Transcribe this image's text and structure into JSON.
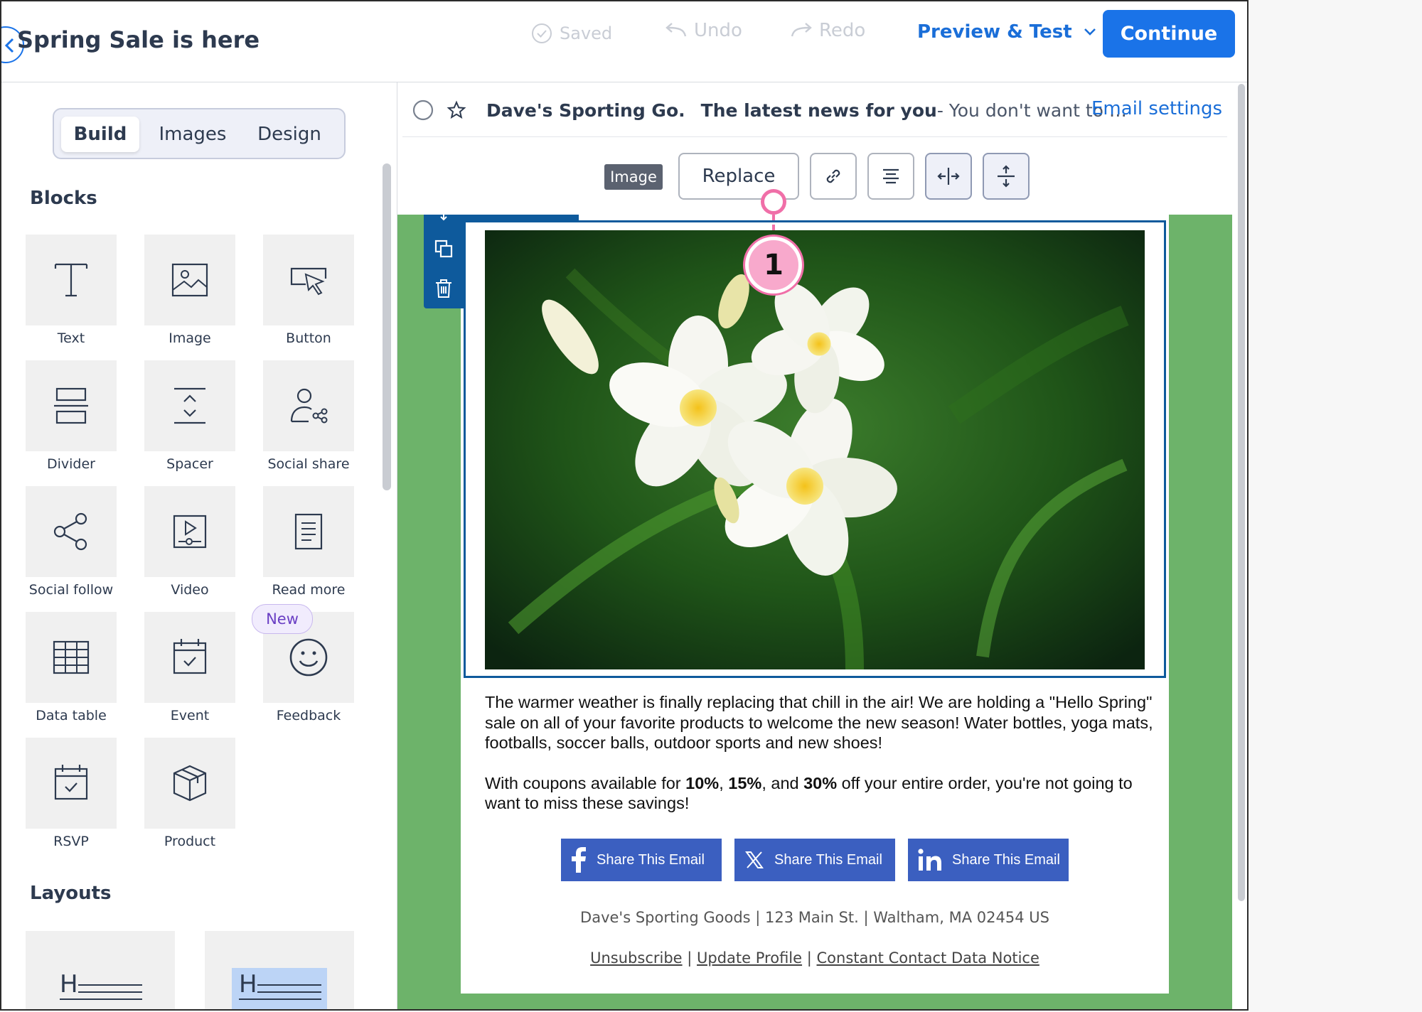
{
  "header": {
    "campaign_title": "Spring Sale is here",
    "saved_label": "Saved",
    "undo_label": "Undo",
    "redo_label": "Redo",
    "preview_label": "Preview & Test",
    "continue_label": "Continue"
  },
  "sidebar": {
    "tabs": [
      "Build",
      "Images",
      "Design"
    ],
    "active_tab": "Build",
    "blocks_heading": "Blocks",
    "blocks": [
      {
        "label": "Text",
        "icon": "text-icon"
      },
      {
        "label": "Image",
        "icon": "image-icon"
      },
      {
        "label": "Button",
        "icon": "button-icon"
      },
      {
        "label": "Divider",
        "icon": "divider-icon"
      },
      {
        "label": "Spacer",
        "icon": "spacer-icon"
      },
      {
        "label": "Social share",
        "icon": "social-share-icon"
      },
      {
        "label": "Social follow",
        "icon": "social-follow-icon"
      },
      {
        "label": "Video",
        "icon": "video-icon"
      },
      {
        "label": "Read more",
        "icon": "read-more-icon"
      },
      {
        "label": "Data table",
        "icon": "data-table-icon"
      },
      {
        "label": "Event",
        "icon": "event-icon"
      },
      {
        "label": "Feedback",
        "icon": "feedback-icon"
      },
      {
        "label": "RSVP",
        "icon": "rsvp-icon"
      },
      {
        "label": "Product",
        "icon": "product-icon"
      }
    ],
    "new_badge": "New",
    "layouts_heading": "Layouts"
  },
  "email_info": {
    "sender": "Dave's Sporting Go.",
    "subject": "The latest news for you",
    "preheader": " - You don't want to …",
    "settings_link": "Email settings"
  },
  "toolbar": {
    "block_type_tag": "Image",
    "replace_label": "Replace"
  },
  "callout": {
    "number": "1",
    "color": "#f06fa8"
  },
  "email": {
    "paragraph1": "The warmer weather is finally replacing that chill in the air! We are holding a \"Hello Spring\" sale on all of your favorite products to welcome the new season! Water bottles, yoga mats, footballs, soccer balls, outdoor sports and new shoes!",
    "paragraph2_a": "With coupons available for ",
    "pct1": "10%",
    "sep1": ", ",
    "pct2": "15%",
    "sep2": ", and ",
    "pct3": "30%",
    "paragraph2_b": " off your entire order, you're not going to want to miss these savings!",
    "share_buttons": [
      {
        "label": "Share This Email",
        "icon": "facebook-icon"
      },
      {
        "label": "Share This Email",
        "icon": "x-icon"
      },
      {
        "label": "Share This Email",
        "icon": "linkedin-icon"
      }
    ],
    "footer_address": "Dave's Sporting Goods | 123 Main St. | Waltham, MA 02454 US",
    "footer_links": [
      "Unsubscribe",
      "Update Profile",
      "Constant Contact Data Notice"
    ],
    "footer_sep": " | "
  },
  "colors": {
    "primary": "#1a73e8",
    "canvas_bg": "#6db36a",
    "selection": "#0e5a9c",
    "share_button": "#3b5fc0"
  }
}
